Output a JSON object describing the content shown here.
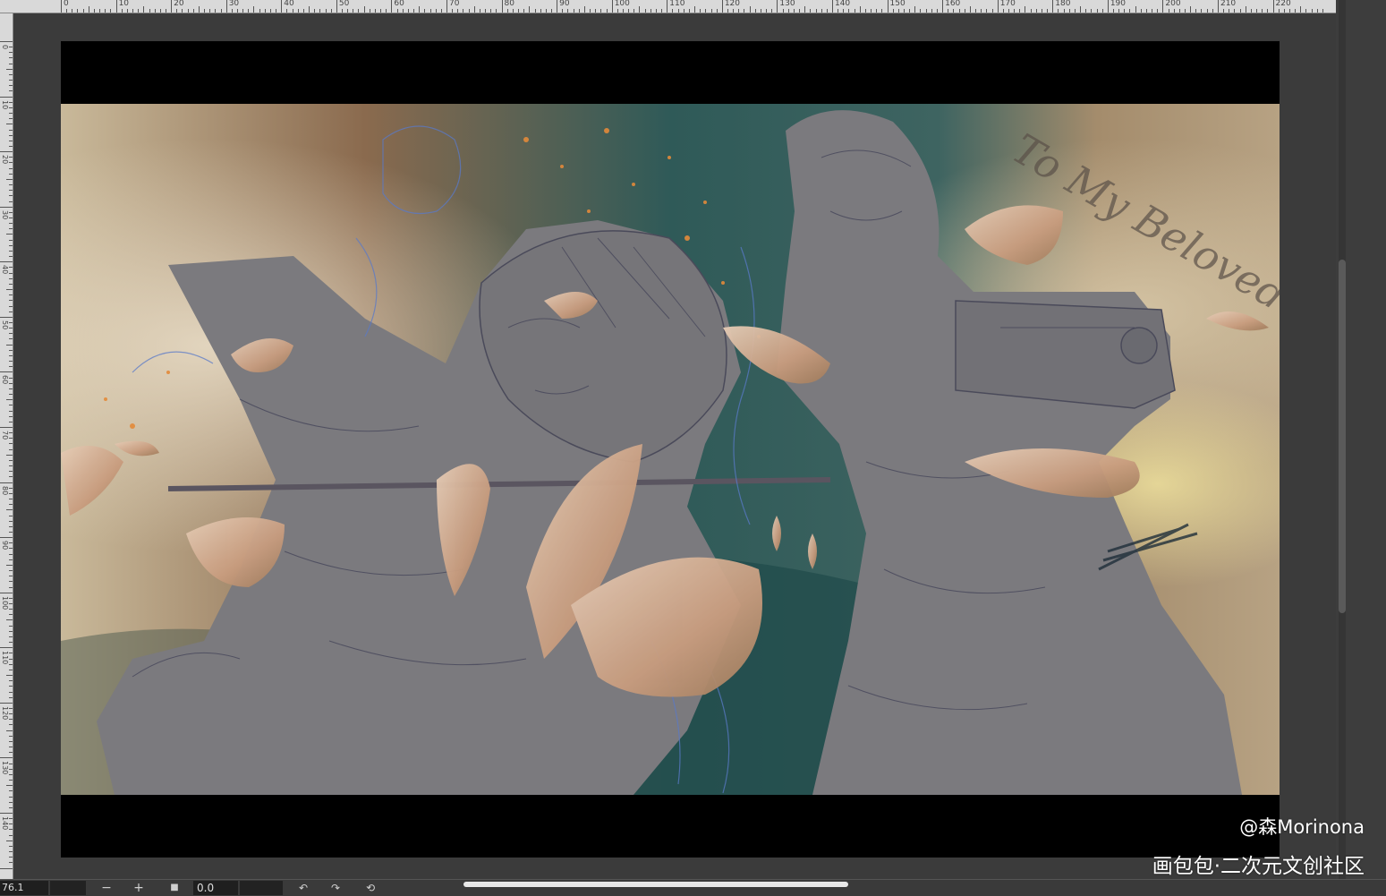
{
  "ruler_top": {
    "labels": [
      "0",
      "10",
      "20",
      "30",
      "40",
      "50",
      "60",
      "70",
      "80",
      "90",
      "100",
      "110",
      "120",
      "130",
      "140",
      "150",
      "160",
      "170",
      "180",
      "190",
      "200",
      "210",
      "220"
    ]
  },
  "ruler_left": {
    "labels": [
      "0",
      "10",
      "20",
      "30",
      "40",
      "50",
      "60",
      "70",
      "80",
      "90",
      "100",
      "110",
      "120",
      "130",
      "140"
    ]
  },
  "toolbar": {
    "zoom_value": "76.1",
    "zoom_out_label": "−",
    "zoom_in_label": "+",
    "fit_label": "■",
    "angle_value": "0.0",
    "rotate_left_label": "↶",
    "rotate_right_label": "↷",
    "reset_rotation_label": "⟲"
  },
  "watermark": {
    "author": "@森Morinona",
    "site": "画包包·二次元文创社区"
  },
  "artwork": {
    "handwriting_text": "To My Beloved V",
    "colors": {
      "sky_light": "#c9b99a",
      "sky_brown": "#8a6a4e",
      "teal": "#2f5a58",
      "figure_gray": "#7b7a7e",
      "leaf": "#d8b79a",
      "ember": "#e38a3a"
    }
  }
}
